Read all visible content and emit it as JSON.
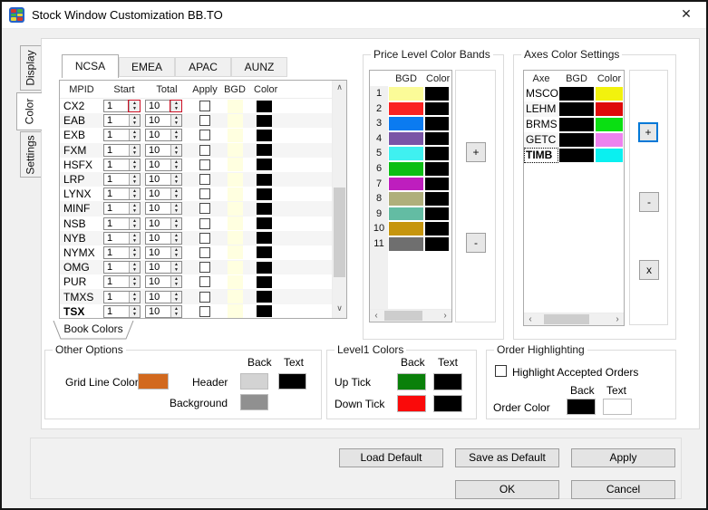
{
  "window": {
    "title": "Stock Window Customization BB.TO"
  },
  "icons": {
    "close": "✕",
    "spinner_up": "▲",
    "spinner_down": "▼",
    "scroll_up": "∧",
    "scroll_down": "∨",
    "scroll_left": "‹",
    "scroll_right": "›"
  },
  "colors": {
    "focus_accent": "#0078D7",
    "spinner_highlight": "#CE1126"
  },
  "side_tabs": {
    "display": "Display",
    "color": "Color",
    "settings": "Settings"
  },
  "market_tabs": {
    "ncsa": "NCSA",
    "emea": "EMEA",
    "apac": "APAC",
    "aunz": "AUNZ"
  },
  "mpid_table": {
    "headers": {
      "mpid": "MPID",
      "start": "Start",
      "total": "Total",
      "apply": "Apply",
      "bgd": "BGD",
      "color": "Color"
    },
    "bgd_color": "#FFFFE0",
    "color_color": "#000000",
    "rows": [
      {
        "mpid": "CX2",
        "start": "1",
        "total": "10",
        "bold": false,
        "highlight": true
      },
      {
        "mpid": "EAB",
        "start": "1",
        "total": "10",
        "bold": false,
        "highlight": false
      },
      {
        "mpid": "EXB",
        "start": "1",
        "total": "10",
        "bold": false,
        "highlight": false
      },
      {
        "mpid": "FXM",
        "start": "1",
        "total": "10",
        "bold": false,
        "highlight": false
      },
      {
        "mpid": "HSFX",
        "start": "1",
        "total": "10",
        "bold": false,
        "highlight": false
      },
      {
        "mpid": "LRP",
        "start": "1",
        "total": "10",
        "bold": false,
        "highlight": false
      },
      {
        "mpid": "LYNX",
        "start": "1",
        "total": "10",
        "bold": false,
        "highlight": false
      },
      {
        "mpid": "MINF",
        "start": "1",
        "total": "10",
        "bold": false,
        "highlight": false
      },
      {
        "mpid": "NSB",
        "start": "1",
        "total": "10",
        "bold": false,
        "highlight": false
      },
      {
        "mpid": "NYB",
        "start": "1",
        "total": "10",
        "bold": false,
        "highlight": false
      },
      {
        "mpid": "NYMX",
        "start": "1",
        "total": "10",
        "bold": false,
        "highlight": false
      },
      {
        "mpid": "OMG",
        "start": "1",
        "total": "10",
        "bold": false,
        "highlight": false
      },
      {
        "mpid": "PUR",
        "start": "1",
        "total": "10",
        "bold": false,
        "highlight": false
      },
      {
        "mpid": "TMXS",
        "start": "1",
        "total": "10",
        "bold": false,
        "highlight": false
      },
      {
        "mpid": "TSX",
        "start": "1",
        "total": "10",
        "bold": true,
        "highlight": false
      }
    ]
  },
  "book_colors_tab": "Book Colors",
  "price_bands": {
    "title": "Price Level Color Bands",
    "headers": {
      "bgd": "BGD",
      "color": "Color"
    },
    "add_label": "+",
    "remove_label": "-",
    "rows": [
      {
        "n": "1",
        "bgd": "#FBFB98",
        "color": "#000000"
      },
      {
        "n": "2",
        "bgd": "#FA2222",
        "color": "#000000"
      },
      {
        "n": "3",
        "bgd": "#0B7BF0",
        "color": "#000000"
      },
      {
        "n": "4",
        "bgd": "#7A55A6",
        "color": "#000000"
      },
      {
        "n": "5",
        "bgd": "#3FF0F0",
        "color": "#000000"
      },
      {
        "n": "6",
        "bgd": "#0BBE14",
        "color": "#000000"
      },
      {
        "n": "7",
        "bgd": "#BE1EBE",
        "color": "#000000"
      },
      {
        "n": "8",
        "bgd": "#AFAF7B",
        "color": "#000000"
      },
      {
        "n": "9",
        "bgd": "#63BCA3",
        "color": "#000000"
      },
      {
        "n": "10",
        "bgd": "#C6950D",
        "color": "#000000"
      },
      {
        "n": "11",
        "bgd": "#6F6F6F",
        "color": "#000000"
      }
    ]
  },
  "axes": {
    "title": "Axes Color Settings",
    "headers": {
      "axe": "Axe",
      "bgd": "BGD",
      "color": "Color"
    },
    "add_label": "+",
    "remove_label": "-",
    "delete_label": "x",
    "rows": [
      {
        "name": "MSCO",
        "bgd": "#000000",
        "color": "#F2F20D",
        "focused": false
      },
      {
        "name": "LEHM",
        "bgd": "#000000",
        "color": "#DE0A0A",
        "focused": false
      },
      {
        "name": "BRMS",
        "bgd": "#000000",
        "color": "#0ADF12",
        "focused": false
      },
      {
        "name": "GETC",
        "bgd": "#000000",
        "color": "#EE82EE",
        "focused": false
      },
      {
        "name": "TIMB",
        "bgd": "#000000",
        "color": "#0AF0F0",
        "focused": true
      }
    ]
  },
  "other_options": {
    "title": "Other Options",
    "grid_line_label": "Grid Line Color",
    "grid_line_color": "#D2691E",
    "back_header": "Back",
    "text_header": "Text",
    "header_label": "Header",
    "header_back": "#D3D3D3",
    "header_text": "#000000",
    "background_label": "Background",
    "background_color": "#909090"
  },
  "level1": {
    "title": "Level1 Colors",
    "back_header": "Back",
    "text_header": "Text",
    "up_label": "Up Tick",
    "up_back": "#0A800A",
    "up_text": "#000000",
    "down_label": "Down Tick",
    "down_back": "#FA0A0A",
    "down_text": "#000000"
  },
  "order_highlighting": {
    "title": "Order Highlighting",
    "checkbox_label": "Highlight Accepted Orders",
    "checked": false,
    "back_header": "Back",
    "text_header": "Text",
    "order_color_label": "Order Color",
    "order_back": "#000000",
    "order_text": "#FFFFFF"
  },
  "footer": {
    "load_default": "Load Default",
    "save_as_default": "Save as Default",
    "apply": "Apply",
    "ok": "OK",
    "cancel": "Cancel"
  }
}
